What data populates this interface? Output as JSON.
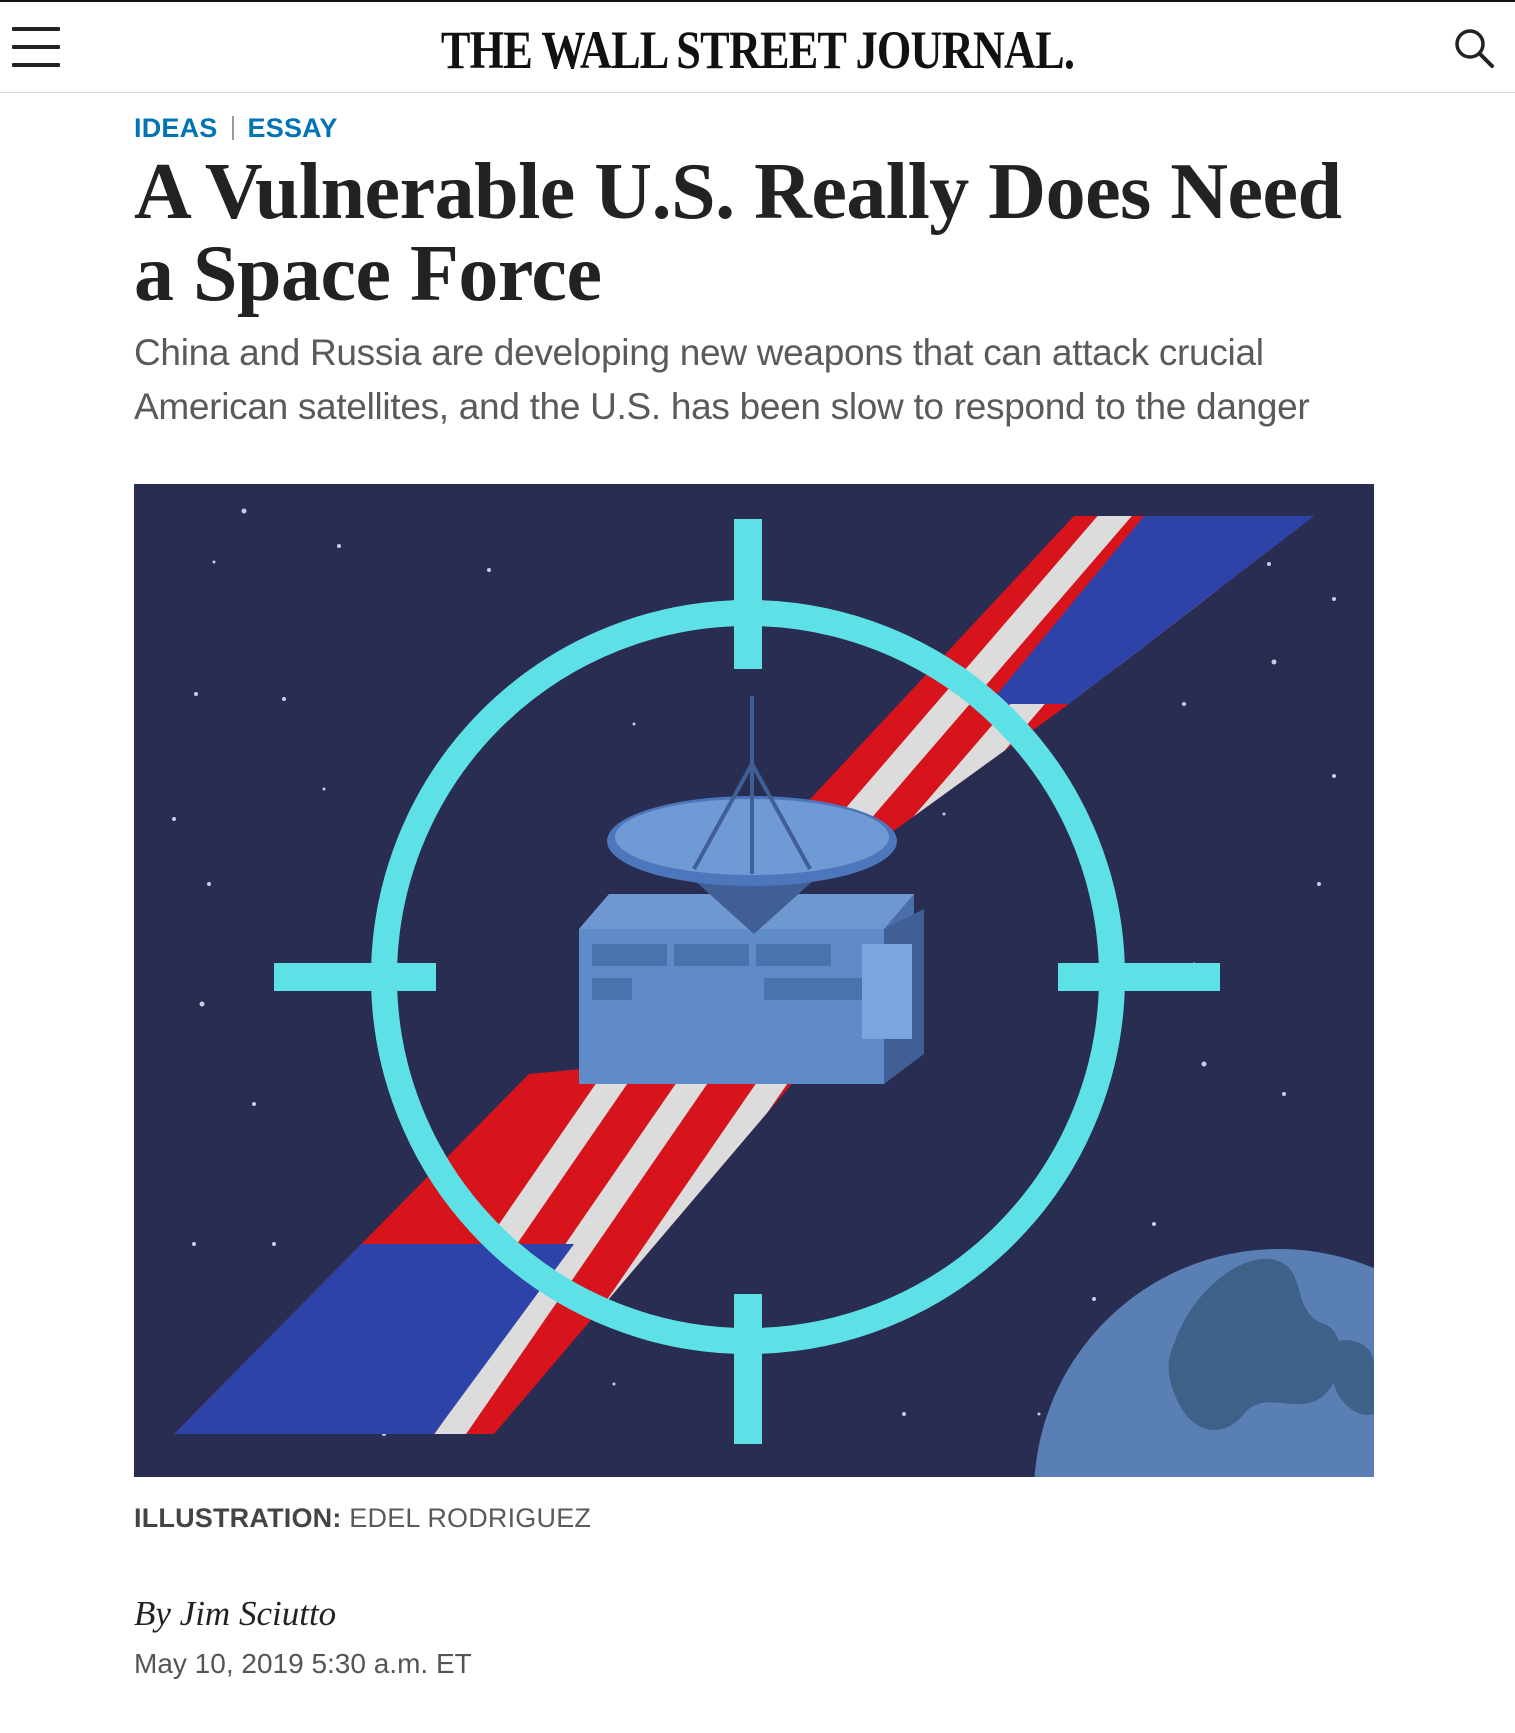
{
  "header": {
    "masthead": "THE WALL STREET JOURNAL.",
    "menu_icon": "hamburger-menu-icon",
    "search_icon": "search-icon"
  },
  "article": {
    "section": "IDEAS",
    "subsection": "ESSAY",
    "headline": "A Vulnerable U.S. Really Does Need a Space Force",
    "dek": "China and Russia are developing new weapons that can attack crucial American satellites, and the U.S. has been slow to respond to the danger",
    "caption_label": "ILLUSTRATION:",
    "caption_credit": "EDEL RODRIGUEZ",
    "byline_prefix": "By",
    "author": "Jim Sciutto",
    "date": "May 10, 2019 5:30 a.m. ET"
  },
  "colors": {
    "kicker": "#0274b6",
    "space_background": "#2a2d52",
    "crosshair": "#5ee1e6",
    "stripe_red": "#d7141b",
    "stripe_white": "#dcdcdc",
    "stripe_blue": "#2e43a8",
    "satellite": "#5f8bc8",
    "earth": "#5a7fb5"
  }
}
